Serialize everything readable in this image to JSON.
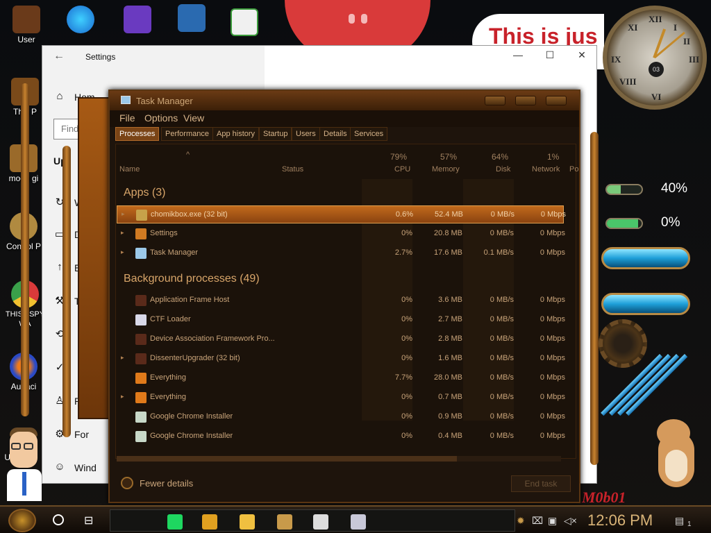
{
  "desktop": {
    "icons": [
      {
        "label": "User",
        "name": "desktop-user-icon",
        "color": "#8a4a2a"
      },
      {
        "label": "This P",
        "name": "desktop-this-pc-icon",
        "color": "#7a4a1a"
      },
      {
        "label": "moon gi",
        "name": "desktop-moon-icon",
        "color": "#9a6a2a"
      },
      {
        "label": "Control P",
        "name": "desktop-control-panel-icon",
        "color": "#b08a40"
      },
      {
        "label": "THIS I SPY WA",
        "name": "desktop-chrome-icon",
        "color": "#d93a3a"
      },
      {
        "label": "Audaci",
        "name": "desktop-audacity-icon",
        "color": "#2a4ac6"
      },
      {
        "label": "UN",
        "name": "desktop-un-icon",
        "color": "#444"
      }
    ],
    "banner_text": "This is jus",
    "gauges": [
      {
        "value": "40%",
        "fraction": 0.4,
        "color": "#7ac97a"
      },
      {
        "value": "0%",
        "fraction": 0.9,
        "color": "#4ac66a"
      }
    ],
    "clock_center": "03",
    "mobot_text": "M0b01"
  },
  "settings": {
    "title": "Settings",
    "home_label": "Hom",
    "search_placeholder": "Find",
    "update_label": "Up",
    "nav_letters": [
      "W",
      "D",
      "E",
      "T",
      "",
      "",
      "P",
      "For",
      "Wind"
    ],
    "controls": {
      "min": "—",
      "max": "☐",
      "close": "✕"
    }
  },
  "taskmanager": {
    "title": "Task Manager",
    "menu": [
      "File",
      "Options",
      "View"
    ],
    "tabs": [
      "Processes",
      "Performance",
      "App history",
      "Startup",
      "Users",
      "Details",
      "Services"
    ],
    "columns": {
      "name": "Name",
      "status": "Status",
      "cpu_pct": "79%",
      "cpu": "CPU",
      "mem_pct": "57%",
      "mem": "Memory",
      "disk_pct": "64%",
      "disk": "Disk",
      "net_pct": "1%",
      "net": "Network",
      "power": "Po"
    },
    "apps_group": "Apps (3)",
    "bg_group": "Background processes (49)",
    "apps": [
      {
        "name": "chomikbox.exe (32 bit)",
        "cpu": "0.6%",
        "mem": "52.4 MB",
        "disk": "0 MB/s",
        "net": "0 Mbps",
        "icon_color": "#c7a24a",
        "expand": true,
        "selected": true
      },
      {
        "name": "Settings",
        "cpu": "0%",
        "mem": "20.8 MB",
        "disk": "0 MB/s",
        "net": "0 Mbps",
        "icon_color": "#d07a22",
        "expand": true
      },
      {
        "name": "Task Manager",
        "cpu": "2.7%",
        "mem": "17.6 MB",
        "disk": "0.1 MB/s",
        "net": "0 Mbps",
        "icon_color": "#9bc8e8",
        "expand": true
      }
    ],
    "background": [
      {
        "name": "Application Frame Host",
        "cpu": "0%",
        "mem": "3.6 MB",
        "disk": "0 MB/s",
        "net": "0 Mbps",
        "icon_color": "#5a2a1a",
        "expand": false
      },
      {
        "name": "CTF Loader",
        "cpu": "0%",
        "mem": "2.7 MB",
        "disk": "0 MB/s",
        "net": "0 Mbps",
        "icon_color": "#d8d8e8",
        "expand": false
      },
      {
        "name": "Device Association Framework Pro...",
        "cpu": "0%",
        "mem": "2.8 MB",
        "disk": "0 MB/s",
        "net": "0 Mbps",
        "icon_color": "#5a2a1a",
        "expand": false
      },
      {
        "name": "DissenterUpgrader (32 bit)",
        "cpu": "0%",
        "mem": "1.6 MB",
        "disk": "0 MB/s",
        "net": "0 Mbps",
        "icon_color": "#5a2a1a",
        "expand": true
      },
      {
        "name": "Everything",
        "cpu": "7.7%",
        "mem": "28.0 MB",
        "disk": "0 MB/s",
        "net": "0 Mbps",
        "icon_color": "#e07a1a",
        "expand": false
      },
      {
        "name": "Everything",
        "cpu": "0%",
        "mem": "0.7 MB",
        "disk": "0 MB/s",
        "net": "0 Mbps",
        "icon_color": "#e07a1a",
        "expand": true
      },
      {
        "name": "Google Chrome Installer",
        "cpu": "0%",
        "mem": "0.9 MB",
        "disk": "0 MB/s",
        "net": "0 Mbps",
        "icon_color": "#c8d8c8",
        "expand": false
      },
      {
        "name": "Google Chrome Installer",
        "cpu": "0%",
        "mem": "0.4 MB",
        "disk": "0 MB/s",
        "net": "0 Mbps",
        "icon_color": "#c8d8c8",
        "expand": false
      }
    ],
    "fewer_details": "Fewer details",
    "end_task": "End task"
  },
  "taskbar": {
    "clock": "12:06 PM",
    "apps": [
      {
        "name": "taskbar-spotify-icon",
        "color": "#1ed760"
      },
      {
        "name": "taskbar-chrome-icon",
        "color": "#e0a020"
      },
      {
        "name": "taskbar-explorer-icon",
        "color": "#f0c040"
      },
      {
        "name": "taskbar-chomikbox-icon",
        "color": "#c89a4a"
      },
      {
        "name": "taskbar-settings-icon",
        "color": "#dddddd"
      },
      {
        "name": "taskbar-taskmanager-icon",
        "color": "#c8c8d8"
      }
    ],
    "notification_count": "1"
  }
}
